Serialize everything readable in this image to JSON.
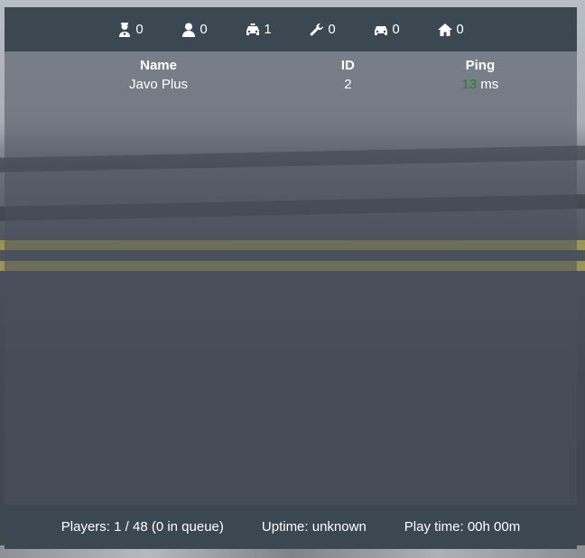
{
  "stats": [
    {
      "icon": "police-officer-icon",
      "count": "0"
    },
    {
      "icon": "user-icon",
      "count": "0"
    },
    {
      "icon": "taxi-icon",
      "count": "1"
    },
    {
      "icon": "wrench-icon",
      "count": "0"
    },
    {
      "icon": "car-icon",
      "count": "0"
    },
    {
      "icon": "home-icon",
      "count": "0"
    }
  ],
  "table": {
    "headers": {
      "name": "Name",
      "id": "ID",
      "ping": "Ping"
    },
    "rows": [
      {
        "name": "Javo Plus",
        "id": "2",
        "ping": "13",
        "ping_unit": "ms"
      }
    ]
  },
  "footer": {
    "players": "Players: 1 / 48 (0 in queue)",
    "uptime": "Uptime: unknown",
    "playtime": "Play time: 00h 00m"
  },
  "colors": {
    "bar_bg": "#3b4751",
    "ping_good": "#1a8a1a"
  }
}
